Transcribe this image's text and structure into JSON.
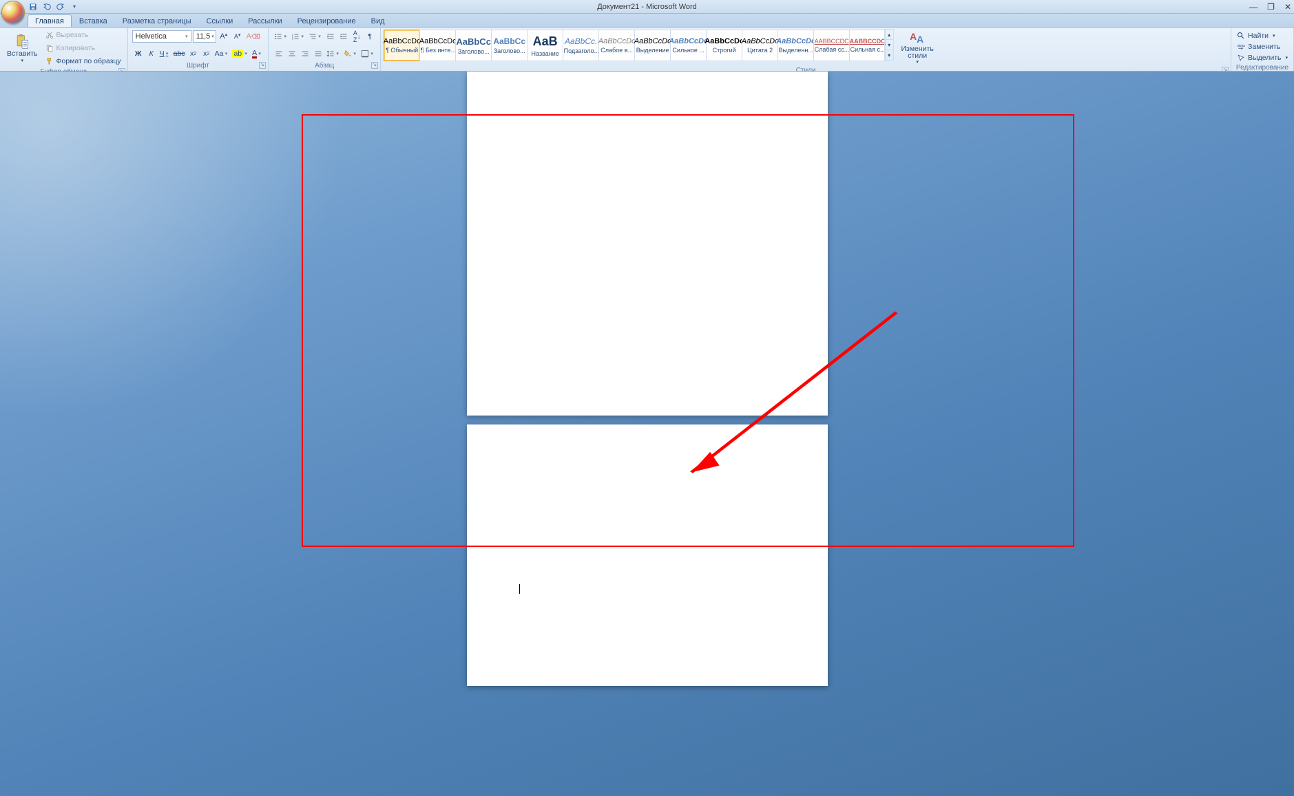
{
  "app": {
    "title": "Документ21 - Microsoft Word"
  },
  "qat": {
    "save": "save",
    "undo": "undo",
    "redo": "redo"
  },
  "sys": {
    "min": "—",
    "max": "❐",
    "close": "✕"
  },
  "tabs": {
    "home": "Главная",
    "insert": "Вставка",
    "layout": "Разметка страницы",
    "refs": "Ссылки",
    "mail": "Рассылки",
    "review": "Рецензирование",
    "view": "Вид"
  },
  "clipboard": {
    "paste": "Вставить",
    "cut": "Вырезать",
    "copy": "Копировать",
    "painter": "Формат по образцу",
    "group": "Буфер обмена"
  },
  "font": {
    "name": "Helvetica",
    "size": "11,5",
    "group": "Шрифт"
  },
  "para": {
    "group": "Абзац"
  },
  "styles": {
    "group": "Стили",
    "change": "Изменить стили",
    "items": [
      {
        "sample": "AaBbCcDc",
        "label": "¶ Обычный",
        "cls": "",
        "sel": true,
        "sstyle": "color:#000"
      },
      {
        "sample": "AaBbCcDc",
        "label": "¶ Без инте...",
        "cls": "",
        "sstyle": "color:#000"
      },
      {
        "sample": "AaBbCc",
        "label": "Заголово...",
        "cls": "",
        "sstyle": "color:#365f91;font-weight:bold;font-size:13px"
      },
      {
        "sample": "AaBbCc",
        "label": "Заголово...",
        "cls": "",
        "sstyle": "color:#4f81bd;font-weight:bold;font-size:12px"
      },
      {
        "sample": "AaB",
        "label": "Название",
        "cls": "",
        "sstyle": "color:#17365d;font-weight:bold;font-size:18px"
      },
      {
        "sample": "AaBbCc.",
        "label": "Подзаголо...",
        "cls": "",
        "sstyle": "color:#4f81bd;font-style:italic;font-size:12px"
      },
      {
        "sample": "AaBbCcDc",
        "label": "Слабое в...",
        "cls": "",
        "sstyle": "color:#808080;font-style:italic"
      },
      {
        "sample": "AaBbCcDc",
        "label": "Выделение",
        "cls": "",
        "sstyle": "color:#000;font-style:italic"
      },
      {
        "sample": "AaBbCcDc",
        "label": "Сильное ...",
        "cls": "",
        "sstyle": "color:#4f81bd;font-style:italic;font-weight:bold"
      },
      {
        "sample": "AaBbCcDc",
        "label": "Строгий",
        "cls": "",
        "sstyle": "color:#000;font-weight:bold"
      },
      {
        "sample": "AaBbCcDc",
        "label": "Цитата 2",
        "cls": "",
        "sstyle": "color:#000;font-style:italic"
      },
      {
        "sample": "AaBbCcDc",
        "label": "Выделенн...",
        "cls": "",
        "sstyle": "color:#4f81bd;font-weight:bold;font-style:italic"
      },
      {
        "sample": "AABBCCDC",
        "label": "Слабая сс...",
        "cls": "",
        "sstyle": "color:#c0504d;text-decoration:underline;font-size:9px"
      },
      {
        "sample": "AABBCCDC",
        "label": "Сильная с...",
        "cls": "",
        "sstyle": "color:#c0504d;text-decoration:underline;font-weight:bold;font-size:9px"
      }
    ]
  },
  "editing": {
    "group": "Редактирование",
    "find": "Найти",
    "replace": "Заменить",
    "select": "Выделить"
  }
}
